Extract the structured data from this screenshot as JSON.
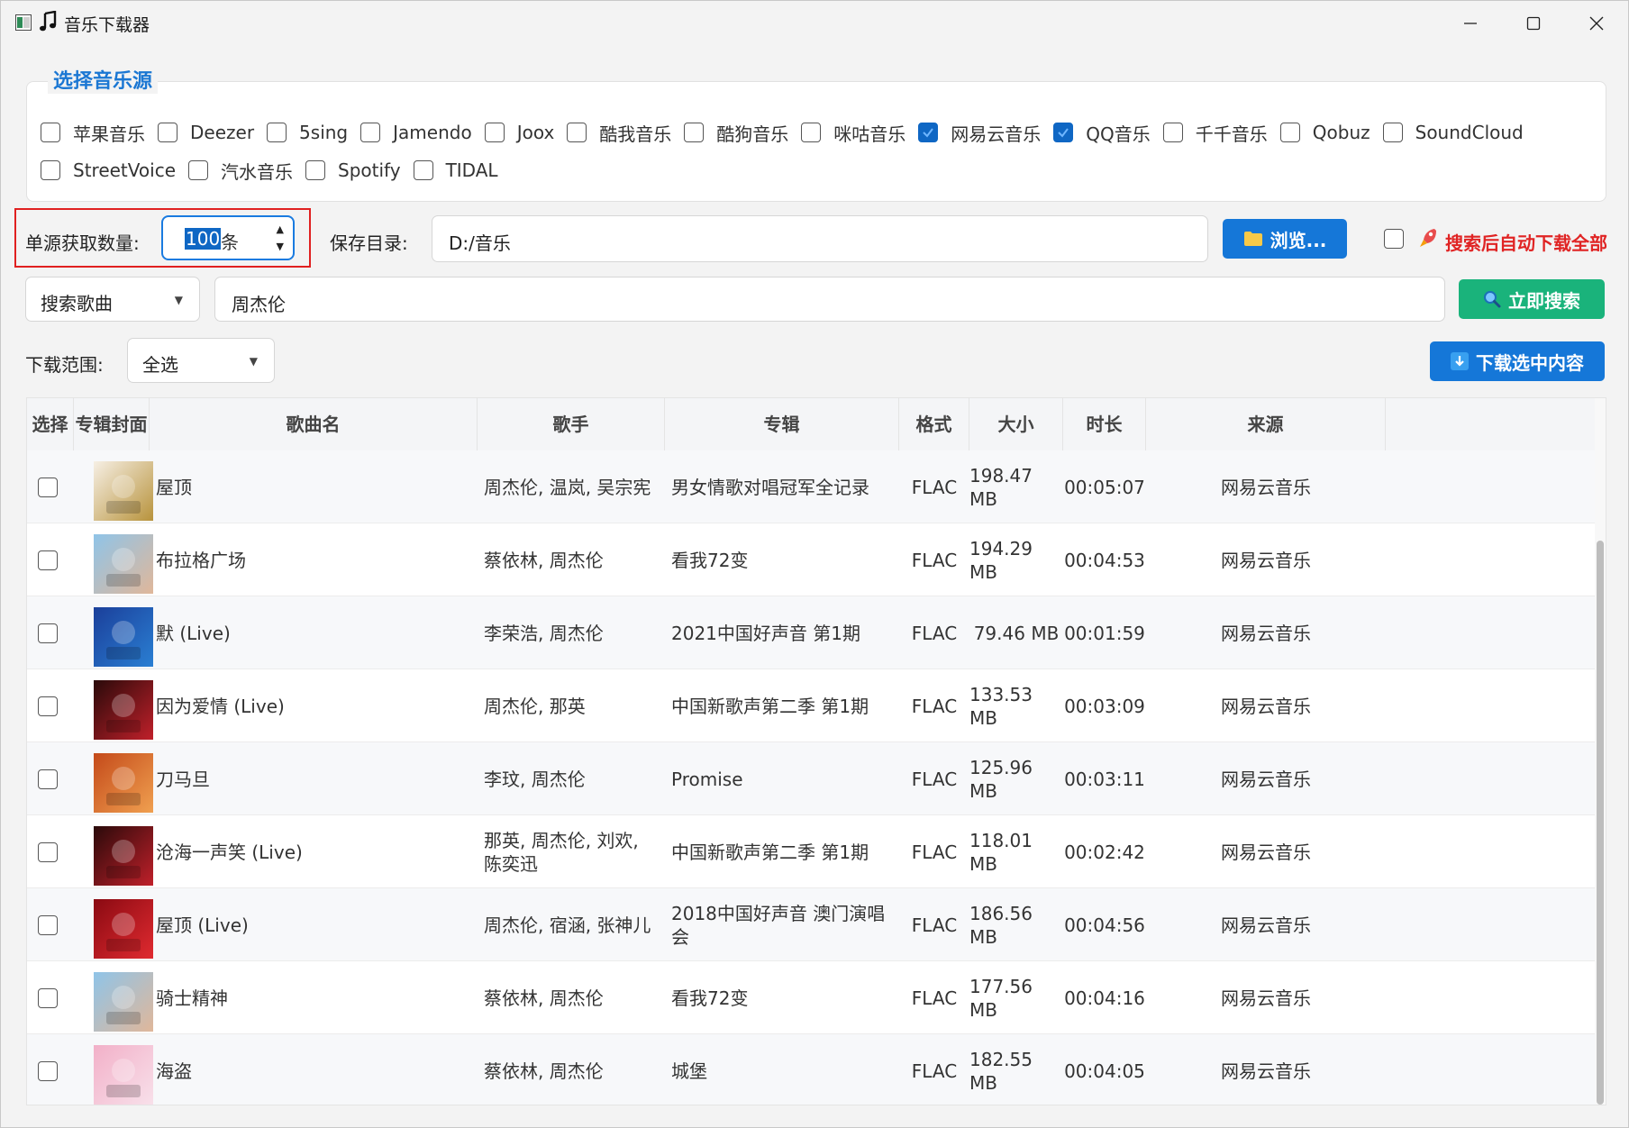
{
  "window": {
    "title": "音乐下载器",
    "app_icon": "app-window-icon",
    "music_icon": "music-note-icon"
  },
  "sources_panel": {
    "title": "选择音乐源",
    "sources": [
      {
        "label": "苹果音乐",
        "checked": false
      },
      {
        "label": "Deezer",
        "checked": false
      },
      {
        "label": "5sing",
        "checked": false
      },
      {
        "label": "Jamendo",
        "checked": false
      },
      {
        "label": "Joox",
        "checked": false
      },
      {
        "label": "酷我音乐",
        "checked": false
      },
      {
        "label": "酷狗音乐",
        "checked": false
      },
      {
        "label": "咪咕音乐",
        "checked": false
      },
      {
        "label": "网易云音乐",
        "checked": true
      },
      {
        "label": "QQ音乐",
        "checked": true
      },
      {
        "label": "千千音乐",
        "checked": false
      },
      {
        "label": "Qobuz",
        "checked": false
      },
      {
        "label": "SoundCloud",
        "checked": false
      },
      {
        "label": "StreetVoice",
        "checked": false
      },
      {
        "label": "汽水音乐",
        "checked": false
      },
      {
        "label": "Spotify",
        "checked": false
      },
      {
        "label": "TIDAL",
        "checked": false
      }
    ]
  },
  "settings": {
    "count_label": "单源获取数量:",
    "count_value": "100",
    "count_suffix": "条",
    "save_dir_label": "保存目录:",
    "save_dir_value": "D:/音乐",
    "browse_label": "浏览...",
    "auto_download_label": "搜索后自动下载全部",
    "auto_download_checked": false
  },
  "search": {
    "type_value": "搜索歌曲",
    "query": "周杰伦",
    "button_label": "立即搜索"
  },
  "download": {
    "range_label": "下载范围:",
    "range_value": "全选",
    "button_label": "下载选中内容"
  },
  "colors": {
    "accent_blue": "#0f67c4",
    "browse_button": "#1577d8",
    "search_button": "#1ab37b",
    "download_button": "#1577d8",
    "highlight_red": "#e02020",
    "auto_download_text": "#e02424"
  },
  "table": {
    "columns": [
      "选择",
      "专辑封面",
      "歌曲名",
      "歌手",
      "专辑",
      "格式",
      "大小",
      "时长",
      "来源"
    ],
    "rows": [
      {
        "title": "屋顶",
        "artist": "周杰伦, 温岚, 吴宗宪",
        "album": "男女情歌对唱冠军全记录",
        "format": "FLAC",
        "size": "198.47 MB",
        "duration": "00:05:07",
        "source": "网易云音乐",
        "cover": [
          "#f6efe4",
          "#b8933c"
        ]
      },
      {
        "title": "布拉格广场",
        "artist": "蔡依林, 周杰伦",
        "album": "看我72变",
        "format": "FLAC",
        "size": "194.29 MB",
        "duration": "00:04:53",
        "source": "网易云音乐",
        "cover": [
          "#8fc4e8",
          "#e0b79a"
        ]
      },
      {
        "title": "默 (Live)",
        "artist": "李荣浩, 周杰伦",
        "album": "2021中国好声音 第1期",
        "format": "FLAC",
        "size": "79.46 MB",
        "duration": "00:01:59",
        "source": "网易云音乐",
        "cover": [
          "#1b3f9a",
          "#2a7fd3"
        ]
      },
      {
        "title": "因为爱情 (Live)",
        "artist": "周杰伦, 那英",
        "album": "中国新歌声第二季 第1期",
        "format": "FLAC",
        "size": "133.53 MB",
        "duration": "00:03:09",
        "source": "网易云音乐",
        "cover": [
          "#2a0a0a",
          "#c0202a"
        ]
      },
      {
        "title": "刀马旦",
        "artist": "李玟, 周杰伦",
        "album": "Promise",
        "format": "FLAC",
        "size": "125.96 MB",
        "duration": "00:03:11",
        "source": "网易云音乐",
        "cover": [
          "#c44a1a",
          "#f0a050"
        ]
      },
      {
        "title": "沧海一声笑 (Live)",
        "artist": "那英, 周杰伦, 刘欢, 陈奕迅",
        "album": "中国新歌声第二季 第1期",
        "format": "FLAC",
        "size": "118.01 MB",
        "duration": "00:02:42",
        "source": "网易云音乐",
        "cover": [
          "#2a0a0a",
          "#c0202a"
        ]
      },
      {
        "title": "屋顶 (Live)",
        "artist": "周杰伦, 宿涵, 张神儿",
        "album": "2018中国好声音 澳门演唱会",
        "format": "FLAC",
        "size": "186.56 MB",
        "duration": "00:04:56",
        "source": "网易云音乐",
        "cover": [
          "#8a0a12",
          "#e02a30"
        ]
      },
      {
        "title": "骑士精神",
        "artist": "蔡依林, 周杰伦",
        "album": "看我72变",
        "format": "FLAC",
        "size": "177.56 MB",
        "duration": "00:04:16",
        "source": "网易云音乐",
        "cover": [
          "#8fc4e8",
          "#e0b79a"
        ]
      },
      {
        "title": "海盗",
        "artist": "蔡依林, 周杰伦",
        "album": "城堡",
        "format": "FLAC",
        "size": "182.55 MB",
        "duration": "00:04:05",
        "source": "网易云音乐",
        "cover": [
          "#f2b0c8",
          "#f8e0ea"
        ]
      }
    ]
  }
}
